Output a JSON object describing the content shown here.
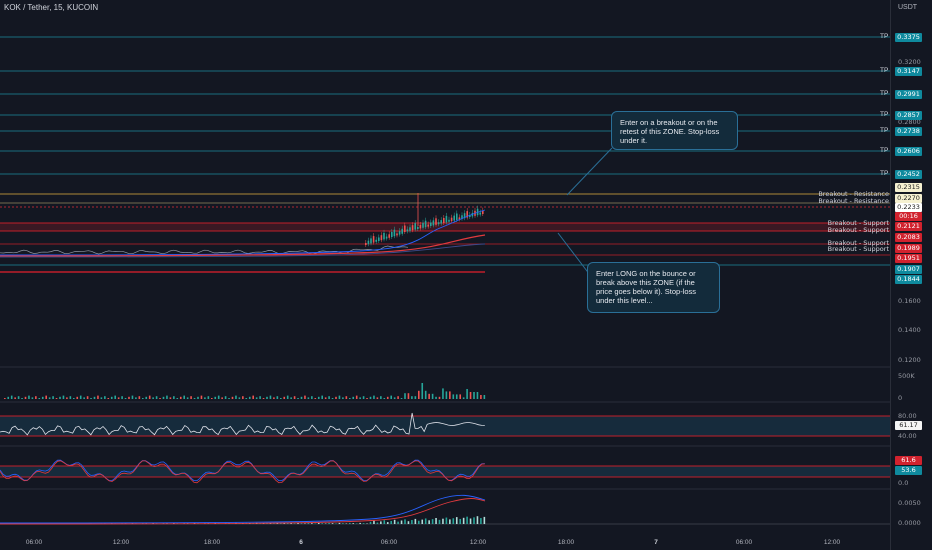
{
  "header": {
    "title": "KOK / Tether, 15, KUCOIN",
    "currency": "USDT"
  },
  "colors": {
    "background": "#131722",
    "teal": "#0f8a9e",
    "red": "#d1222e",
    "cream": "#f5f0d0",
    "white": "#ffffff"
  },
  "tp": {
    "label": "TP"
  },
  "price_axis": {
    "labels": [
      "0.3200",
      "0.2800",
      "0.1600",
      "0.1400",
      "0.1200"
    ],
    "tags": [
      {
        "value": "0.3375",
        "color": "teal"
      },
      {
        "value": "0.3147",
        "color": "teal"
      },
      {
        "value": "0.2991",
        "color": "teal"
      },
      {
        "value": "0.2857",
        "color": "teal"
      },
      {
        "value": "0.2738",
        "color": "teal"
      },
      {
        "value": "0.2606",
        "color": "teal"
      },
      {
        "value": "0.2452",
        "color": "teal"
      },
      {
        "value": "0.2315",
        "color": "cream"
      },
      {
        "value": "0.2270",
        "color": "cream"
      },
      {
        "value": "0.2233",
        "color": "white"
      },
      {
        "value": "00:16",
        "color": "red"
      },
      {
        "value": "0.2121",
        "color": "red"
      },
      {
        "value": "0.2083",
        "color": "red"
      },
      {
        "value": "0.1989",
        "color": "red"
      },
      {
        "value": "0.1951",
        "color": "red"
      },
      {
        "value": "0.1907",
        "color": "teal"
      },
      {
        "value": "0.1844",
        "color": "teal"
      }
    ]
  },
  "lines": {
    "breakout_resistance": "Breakout - Resistance",
    "breakout_support": "Breakout - Support"
  },
  "callouts": {
    "top": "Enter on a breakout or on the retest of this ZONE. Stop-loss under it.",
    "bottom": "Enter LONG on the bounce or break above this ZONE (if the price goes below it). Stop-loss under this level..."
  },
  "volume_pane": {
    "labels": [
      "500K",
      "0"
    ]
  },
  "rsi_pane": {
    "labels": [
      "80.00",
      "40.00"
    ],
    "current": "61.17"
  },
  "stoch_pane": {
    "labels": [
      "61.6",
      "53.6",
      "0.0"
    ]
  },
  "macd_pane": {
    "labels": [
      "0.0050",
      "0.0000"
    ]
  },
  "time_axis": {
    "ticks": [
      {
        "label": "06:00",
        "bold": false
      },
      {
        "label": "12:00",
        "bold": false
      },
      {
        "label": "18:00",
        "bold": false
      },
      {
        "label": "6",
        "bold": true
      },
      {
        "label": "06:00",
        "bold": false
      },
      {
        "label": "12:00",
        "bold": false
      },
      {
        "label": "18:00",
        "bold": false
      },
      {
        "label": "7",
        "bold": true
      },
      {
        "label": "06:00",
        "bold": false
      },
      {
        "label": "12:00",
        "bold": false
      }
    ]
  }
}
